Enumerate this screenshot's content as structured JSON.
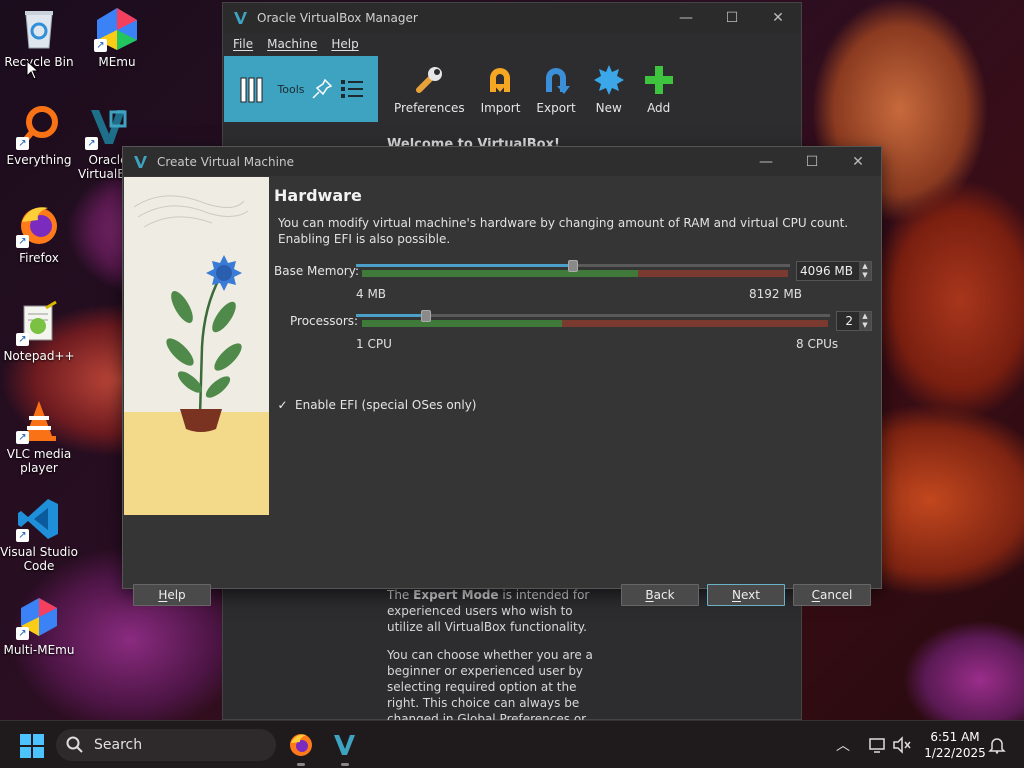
{
  "desktop": {
    "icons": [
      {
        "label": "Recycle Bin"
      },
      {
        "label": "MEmu"
      },
      {
        "label": "Everything"
      },
      {
        "label": "Oracle VirtualBox"
      },
      {
        "label": "Firefox"
      },
      {
        "label": "Notepad++"
      },
      {
        "label": "VLC media player"
      },
      {
        "label": "Visual Studio Code"
      },
      {
        "label": "Multi-MEmu"
      }
    ]
  },
  "manager": {
    "title": "Oracle VirtualBox Manager",
    "menu": [
      "File",
      "Machine",
      "Help"
    ],
    "tools_label": "Tools",
    "toolbar": [
      "Preferences",
      "Import",
      "Export",
      "New",
      "Add"
    ],
    "welcome": "Welcome to VirtualBox!",
    "text1_pre": "The ",
    "text1_bold": "Expert Mode",
    "text1_post": " is intended for experienced users who wish to utilize all VirtualBox functionality.",
    "text2": "You can choose whether you are a beginner or experienced user by selecting required option at the right. This choice can always be changed in Global Preferences or Machine"
  },
  "dialog": {
    "title": "Create Virtual Machine",
    "heading": "Hardware",
    "description": "You can modify virtual machine's hardware by changing amount of RAM and virtual CPU count. Enabling EFI is also possible.",
    "memory": {
      "label": "Base Memory:",
      "value": "4096 MB",
      "min_label": "4 MB",
      "max_label": "8192 MB",
      "fraction": 0.5
    },
    "processors": {
      "label": "Processors:",
      "value": "2",
      "min_label": "1 CPU",
      "max_label": "8 CPUs",
      "fraction": 0.14
    },
    "efi": {
      "label": "Enable EFI (special OSes only)",
      "checked": true
    },
    "buttons": {
      "help": "Help",
      "back": "Back",
      "next": "Next",
      "cancel": "Cancel"
    }
  },
  "taskbar": {
    "search_placeholder": "Search",
    "time": "6:51 AM",
    "date": "1/22/2025"
  }
}
